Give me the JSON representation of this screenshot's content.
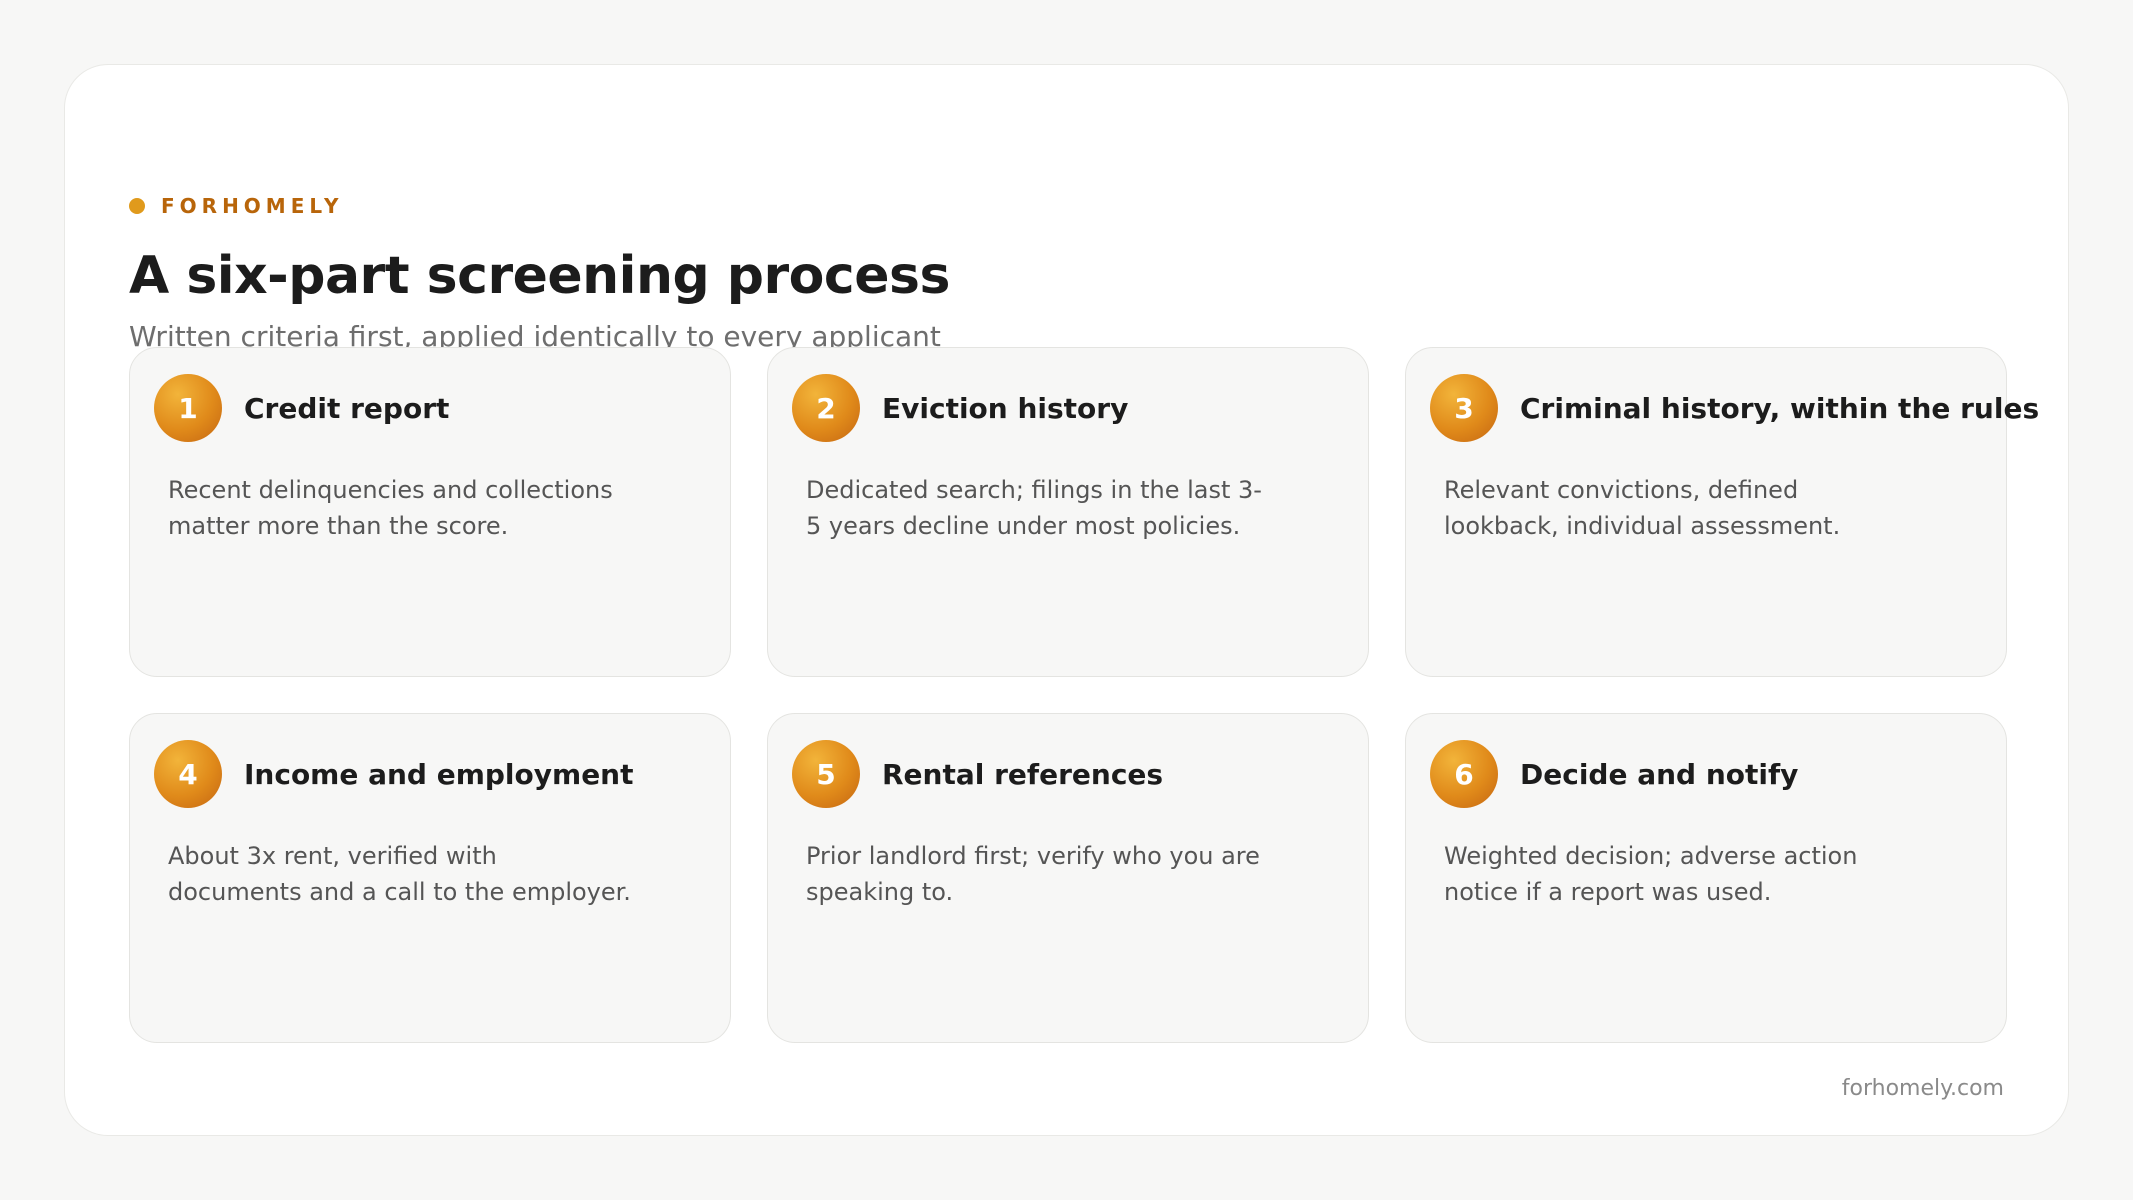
{
  "brand": {
    "name": "FORHOMELY",
    "dot_color": "#e09a1c"
  },
  "header": {
    "title": "A six-part screening process",
    "subtitle": "Written criteria first, applied identically to every applicant"
  },
  "steps": [
    {
      "number": "1",
      "title": "Credit report",
      "body": "Recent delinquencies and collections matter more than the score."
    },
    {
      "number": "2",
      "title": "Eviction history",
      "body": "Dedicated search; filings in the last 3-5 years decline under most policies."
    },
    {
      "number": "3",
      "title": "Criminal history, within the rules",
      "body": "Relevant convictions, defined lookback, individual assessment."
    },
    {
      "number": "4",
      "title": "Income and employment",
      "body": "About 3x rent, verified with documents and a call to the employer."
    },
    {
      "number": "5",
      "title": "Rental references",
      "body": "Prior landlord first; verify who you are speaking to."
    },
    {
      "number": "6",
      "title": "Decide and notify",
      "body": "Weighted decision; adverse action notice if a report was used."
    }
  ],
  "footer": {
    "site": "forhomely.com"
  },
  "colors": {
    "accent": "#e08a1a",
    "brand_text": "#b8650a"
  }
}
